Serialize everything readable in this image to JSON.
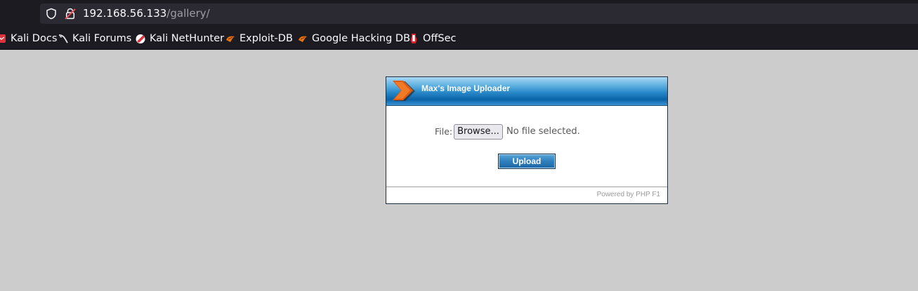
{
  "browser": {
    "url_host": "192.168.56.133",
    "url_path": "/gallery/",
    "icons": {
      "shield": "tracking-protection-shield-icon",
      "lock": "insecure-connection-lock-icon"
    },
    "bookmarks": [
      {
        "label": "Kali Docs",
        "icon": "kali-docs-icon"
      },
      {
        "label": "Kali Forums",
        "icon": "kali-forums-icon"
      },
      {
        "label": "Kali NetHunter",
        "icon": "kali-nethunter-icon"
      },
      {
        "label": "Exploit-DB",
        "icon": "exploit-db-icon"
      },
      {
        "label": "Google Hacking DB",
        "icon": "google-hacking-db-icon"
      },
      {
        "label": "OffSec",
        "icon": "offsec-icon"
      }
    ]
  },
  "uploader": {
    "title": "Max's Image Uploader",
    "file_label": "File:",
    "browse_label": "Browse...",
    "no_file_text": "No file selected.",
    "upload_label": "Upload",
    "footer": "Powered by PHP F1"
  },
  "colors": {
    "page_background": "#cccccc",
    "browser_chrome": "#1c1b22",
    "header_blue": "#2888c8",
    "logo_orange": "#e05a10"
  }
}
